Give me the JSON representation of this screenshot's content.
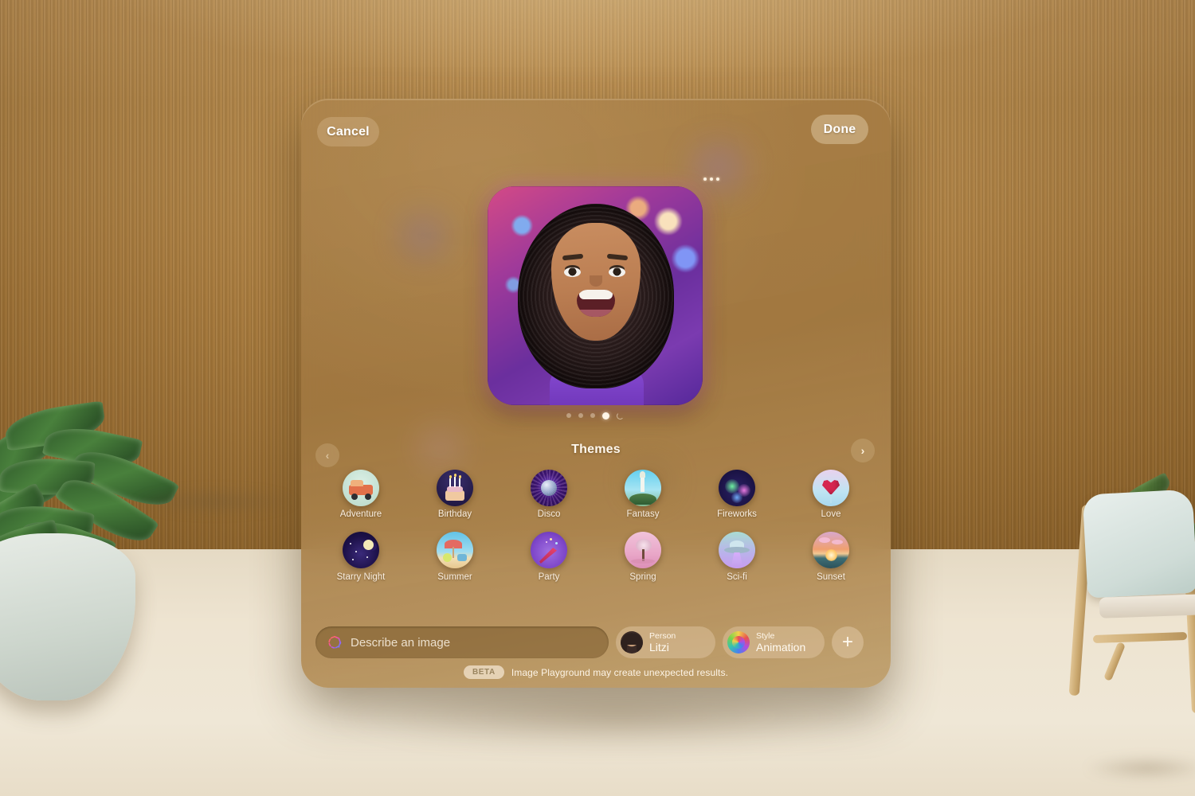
{
  "scene": {
    "description": "augmented-reality floating panel over wood slat wall room",
    "background_objects": [
      "wood-slat-wall",
      "potted-plant",
      "wooden-chair",
      "floor"
    ]
  },
  "panel": {
    "app_name": "Image Playground",
    "header": {
      "cancel_label": "Cancel",
      "done_label": "Done",
      "more_label": "•••"
    },
    "preview": {
      "alt": "generated animated portrait of smiling woman with curly hair at a party",
      "pager": {
        "count": 5,
        "active_index": 3,
        "loading_index": 4
      }
    },
    "themes": {
      "title": "Themes",
      "prev_label": "‹",
      "next_label": "›",
      "items": [
        {
          "label": "Adventure",
          "icon": "adventure-icon",
          "row": 1,
          "colors": [
            "#cfe7dc",
            "#e2704a"
          ]
        },
        {
          "label": "Birthday",
          "icon": "birthday-icon",
          "row": 1,
          "colors": [
            "#231c44",
            "#f0c9a0"
          ]
        },
        {
          "label": "Disco",
          "icon": "disco-icon",
          "row": 1,
          "colors": [
            "#2b1152",
            "#c6d8ea"
          ]
        },
        {
          "label": "Fantasy",
          "icon": "fantasy-icon",
          "row": 1,
          "colors": [
            "#4fc3e8",
            "#f0f3e8"
          ]
        },
        {
          "label": "Fireworks",
          "icon": "fireworks-icon",
          "row": 1,
          "colors": [
            "#191044",
            "#5fe08a"
          ]
        },
        {
          "label": "Love",
          "icon": "love-icon",
          "row": 1,
          "colors": [
            "#cfeaf5",
            "#d6254f"
          ]
        },
        {
          "label": "Starry Night",
          "icon": "starry-night-icon",
          "row": 2,
          "colors": [
            "#1d1048",
            "#f3e9b8"
          ]
        },
        {
          "label": "Summer",
          "icon": "summer-icon",
          "row": 2,
          "colors": [
            "#63c3e8",
            "#f2dfb4"
          ]
        },
        {
          "label": "Party",
          "icon": "party-icon",
          "row": 2,
          "colors": [
            "#8f5fd8",
            "#e8446e"
          ]
        },
        {
          "label": "Spring",
          "icon": "spring-icon",
          "row": 2,
          "colors": [
            "#eaa8c9",
            "#f3dbe6"
          ]
        },
        {
          "label": "Sci-fi",
          "icon": "sci-fi-icon",
          "row": 2,
          "colors": [
            "#a9d6cf",
            "#c79bf0"
          ]
        },
        {
          "label": "Sunset",
          "icon": "sunset-icon",
          "row": 2,
          "colors": [
            "#d7a6c8",
            "#ef8f4a"
          ]
        }
      ]
    },
    "composer": {
      "prompt_placeholder": "Describe an image",
      "prompt_value": "",
      "prompt_icon": "apple-intelligence-icon",
      "chips": [
        {
          "key": "Person",
          "value": "Litzi",
          "icon": "person-avatar"
        },
        {
          "key": "Style",
          "value": "Animation",
          "icon": "style-swatch-icon"
        }
      ],
      "add_label": "+"
    },
    "footer": {
      "badge": "BETA",
      "text": "Image Playground may create unexpected results."
    }
  },
  "colors": {
    "panel_bg": "#a87e45",
    "accent_text": "#fff6e8",
    "prompt_bg": "#78582a",
    "chip_bg": "#e6d0ae",
    "wall": "#c79650",
    "floor": "#eee4d1"
  }
}
